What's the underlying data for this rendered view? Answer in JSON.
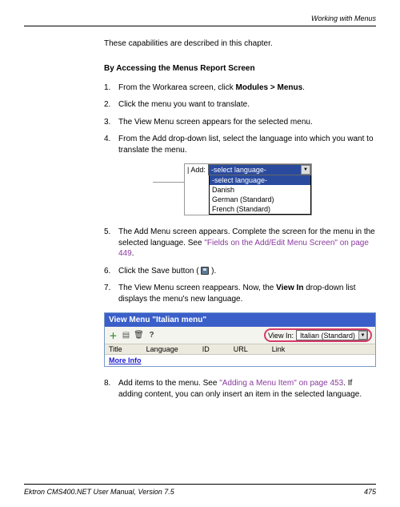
{
  "header": {
    "section": "Working with Menus"
  },
  "intro": "These capabilities are described in this chapter.",
  "heading": "By Accessing the Menus Report Screen",
  "steps": {
    "s1_a": "From the Workarea screen, click ",
    "s1_b": "Modules > Menus",
    "s1_c": ".",
    "s2": "Click the menu you want to translate.",
    "s3": "The View Menu screen appears for the selected menu.",
    "s4": "From the Add drop-down list, select the language into which you want to translate the menu.",
    "s5_a": "The Add Menu screen appears. Complete the screen for the menu in the selected language. See ",
    "s5_link": "\"Fields on the Add/Edit Menu Screen\" on page 449",
    "s5_b": ".",
    "s6_a": "Click the Save button ( ",
    "s6_b": " ).",
    "s7_a": "The View Menu screen reappears. Now, the ",
    "s7_b": "View In",
    "s7_c": " drop-down list displays the menu's new language.",
    "s8_a": "Add items to the menu. See ",
    "s8_link": "\"Adding a Menu Item\" on page 453",
    "s8_b": ". If adding content, you can only insert an item in the selected language."
  },
  "nums": {
    "n1": "1.",
    "n2": "2.",
    "n3": "3.",
    "n4": "4.",
    "n5": "5.",
    "n6": "6.",
    "n7": "7.",
    "n8": "8."
  },
  "fig1": {
    "add_label": "| Add:",
    "selected": "-select language-",
    "options": {
      "o0": "-select language-",
      "o1": "Danish",
      "o2": "German (Standard)",
      "o3": "French (Standard)"
    }
  },
  "fig2": {
    "title": "View Menu \"Italian menu\"",
    "viewin_label": "View In:",
    "viewin_value": "Italian (Standard)",
    "cols": {
      "c0": "Title",
      "c1": "Language",
      "c2": "ID",
      "c3": "URL",
      "c4": "Link"
    },
    "row_link": "More Info"
  },
  "footer": {
    "left": "Ektron CMS400.NET User Manual, Version 7.5",
    "right": "475"
  }
}
